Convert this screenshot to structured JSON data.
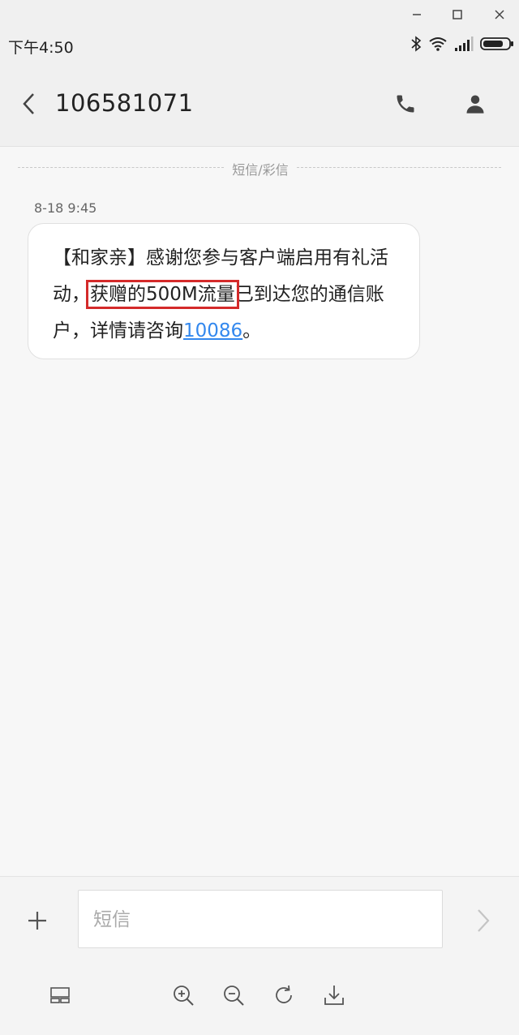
{
  "window_controls": [
    "minimize-icon",
    "maximize-icon",
    "close-icon"
  ],
  "status": {
    "time": "下午4:50",
    "icons": [
      "bluetooth-icon",
      "wifi-icon",
      "signal-icon",
      "battery-icon"
    ]
  },
  "header": {
    "title": "106581071",
    "icons": [
      "back-arrow-icon",
      "phone-icon",
      "contact-icon"
    ]
  },
  "thread": {
    "divider_label": "短信/彩信",
    "date": "8-18 9:45",
    "message": {
      "part1": "【和家亲】感谢您参与客户端启用有礼活动，",
      "highlight": "获赠的500M流量",
      "part2": "已到达您的通信账户，详情请咨询",
      "link": "10086",
      "part3": "。"
    }
  },
  "compose": {
    "placeholder": "短信",
    "icons": [
      "plus-icon",
      "send-arrow-icon"
    ]
  },
  "toolbar": {
    "icons": [
      "layout-icon",
      "zoom-in-icon",
      "zoom-out-icon",
      "rotate-icon",
      "download-icon"
    ]
  },
  "colors": {
    "highlight_border": "#d42a2a",
    "link": "#3388ee",
    "background": "#f7f7f7"
  }
}
